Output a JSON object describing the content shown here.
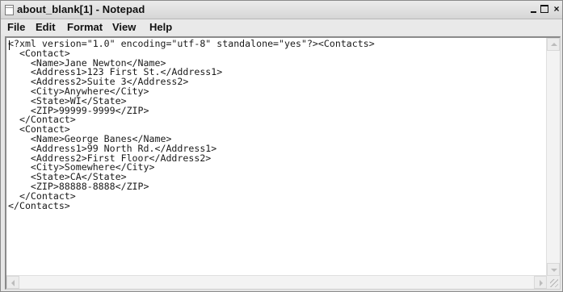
{
  "window": {
    "title": "about_blank[1] - Notepad"
  },
  "controls": {
    "minimize": "",
    "maximize": "",
    "close": "×"
  },
  "menu": {
    "file": "File",
    "edit": "Edit",
    "format": "Format",
    "view": "View",
    "help": "Help"
  },
  "document": {
    "content": "<?xml version=\"1.0\" encoding=\"utf-8\" standalone=\"yes\"?><Contacts>\n  <Contact>\n    <Name>Jane Newton</Name>\n    <Address1>123 First St.</Address1>\n    <Address2>Suite 3</Address2>\n    <City>Anywhere</City>\n    <State>WI</State>\n    <ZIP>99999-9999</ZIP>\n  </Contact>\n  <Contact>\n    <Name>George Banes</Name>\n    <Address1>99 North Rd.</Address1>\n    <Address2>First Floor</Address2>\n    <City>Somewhere</City>\n    <State>CA</State>\n    <ZIP>88888-8888</ZIP>\n  </Contact>\n</Contacts>"
  }
}
